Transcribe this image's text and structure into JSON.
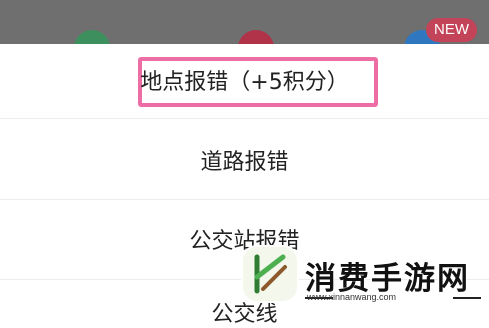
{
  "top_bar": {
    "badge": "NEW"
  },
  "menu": {
    "items": [
      {
        "label": "地点报错（+5积分）"
      },
      {
        "label": "道路报错"
      },
      {
        "label": "公交站报错"
      },
      {
        "label": "公交线"
      }
    ],
    "highlight_color": "#ec6ea5"
  },
  "watermark": {
    "name": "消费手游网",
    "url": "www.xinnanwang.com"
  }
}
